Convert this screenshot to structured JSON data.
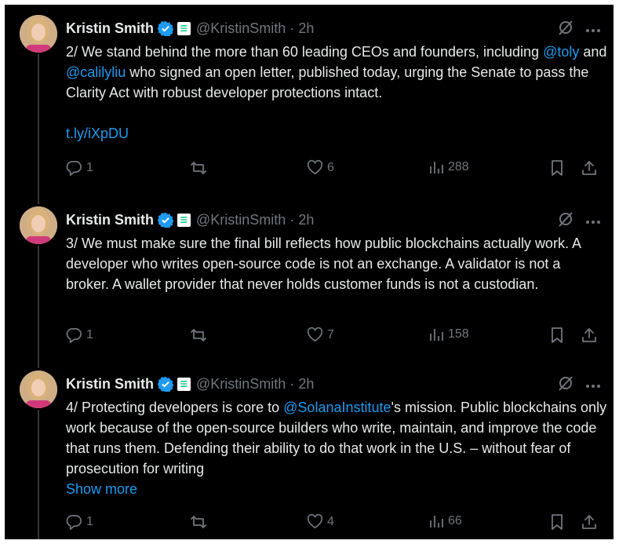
{
  "author": {
    "name": "Kristin Smith",
    "handle": "@KristinSmith",
    "sep": "·"
  },
  "icons": {
    "verified": "verified-badge-icon",
    "affiliate": "solana-affiliate-badge-icon",
    "grok": "grok-icon",
    "more": "more-icon",
    "reply": "reply-icon",
    "repost": "repost-icon",
    "like": "like-icon",
    "views": "views-icon",
    "bookmark": "bookmark-icon",
    "share": "share-icon"
  },
  "colors": {
    "background": "#000000",
    "text": "#e7e9ea",
    "secondary": "#71767b",
    "accent": "#1d9bf0",
    "verified": "#1d9bf0"
  },
  "tweets": [
    {
      "time": "2h",
      "text": {
        "a": "2/ We stand behind the more than 60 leading CEOs and founders, including ",
        "m1": "@toly",
        "b": " and ",
        "m2": "@calilyliu",
        "c": " who signed an open letter, published today, urging the Senate to pass the Clarity Act with robust developer protections intact.",
        "link": "t.ly/iXpDU"
      },
      "replies": "1",
      "reposts": "",
      "likes": "6",
      "views": "288"
    },
    {
      "time": "2h",
      "text": {
        "a": "3/ We must make sure the final bill reflects how public blockchains actually work. A developer who writes open-source code is not an exchange. A validator is not a broker. A wallet provider that never holds customer funds is not a custodian."
      },
      "replies": "1",
      "reposts": "",
      "likes": "7",
      "views": "158"
    },
    {
      "time": "2h",
      "text": {
        "a": "4/ Protecting developers is core to ",
        "m1": "@SolanaInstitute",
        "b": "'s mission. Public blockchains only work because of the open-source builders who write, maintain, and improve the code that runs them. Defending their ability to do that work in the U.S. – without fear of prosecution for writing",
        "show_more": "Show more"
      },
      "replies": "1",
      "reposts": "",
      "likes": "4",
      "views": "66"
    }
  ]
}
